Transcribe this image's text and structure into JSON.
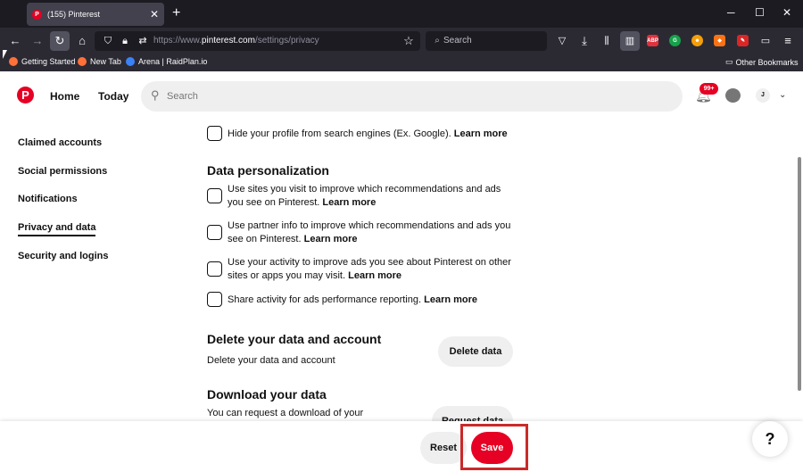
{
  "browser": {
    "tab_title": "(155) Pinterest",
    "url_prefix": "https://www.",
    "url_domain": "pinterest.com",
    "url_path": "/settings/privacy",
    "search_placeholder": "Search",
    "bookmarks": [
      "Getting Started",
      "New Tab",
      "Arena | RaidPlan.io"
    ],
    "other_bookmarks": "Other Bookmarks",
    "ext_abp": "ABP"
  },
  "header": {
    "logo": "P",
    "home": "Home",
    "today": "Today",
    "search_placeholder": "Search",
    "notification_count": "99+",
    "avatar_initial": "J"
  },
  "sidebar": {
    "items": [
      {
        "label": "Claimed accounts"
      },
      {
        "label": "Social permissions"
      },
      {
        "label": "Notifications"
      },
      {
        "label": "Privacy and data",
        "active": true
      },
      {
        "label": "Security and logins"
      }
    ]
  },
  "main": {
    "hide_profile": {
      "text": "Hide your profile from search engines (Ex. Google).",
      "link": "Learn more",
      "checked": false
    },
    "data_personalization_heading": "Data personalization",
    "options": [
      {
        "text": "Use sites you visit to improve which recommendations and ads you see on Pinterest.",
        "link": "Learn more",
        "checked": false
      },
      {
        "text": "Use partner info to improve which recommendations and ads you see on Pinterest.",
        "link": "Learn more",
        "checked": false
      },
      {
        "text": "Use your activity to improve ads you see about Pinterest on other sites or apps you may visit.",
        "link": "Learn more",
        "checked": false
      },
      {
        "text": "Share activity for ads performance reporting.",
        "link": "Learn more",
        "checked": false
      }
    ],
    "delete_heading": "Delete your data and account",
    "delete_desc": "Delete your data and account",
    "delete_button": "Delete data",
    "download_heading": "Download your data",
    "download_desc": "You can request a download of your",
    "download_button": "Request data"
  },
  "footer": {
    "reset": "Reset",
    "save": "Save",
    "help": "?"
  },
  "colors": {
    "brand": "#e60023",
    "highlight": "#c92a2a"
  }
}
